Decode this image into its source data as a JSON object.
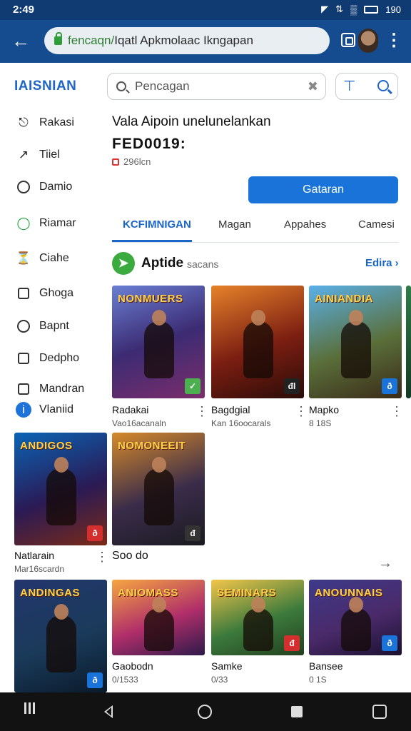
{
  "status_bar": {
    "time": "2:49",
    "battery_text": "190"
  },
  "app_bar": {
    "url_host": "fencaqn/",
    "url_path": "Iqatl Apkmolaac Ikngapan"
  },
  "sidebar": {
    "brand": "IAISNIAN",
    "items": [
      {
        "label": "Rakasi",
        "icon": "tag-icon"
      },
      {
        "label": "Tiiel",
        "icon": "share-icon"
      },
      {
        "label": "Damio",
        "icon": "search-icon"
      },
      {
        "label": "Riamar",
        "icon": "shield-icon"
      },
      {
        "label": "Ciahe",
        "icon": "timer-icon"
      },
      {
        "label": "Ghoga",
        "icon": "calendar-icon"
      },
      {
        "label": "Bapnt",
        "icon": "refresh-icon"
      },
      {
        "label": "Dedpho",
        "icon": "checklist-icon"
      },
      {
        "label": "Mandran",
        "icon": "document-icon"
      },
      {
        "label": "Vlaniid",
        "icon": "info-icon"
      }
    ]
  },
  "search": {
    "placeholder": "Pencagan"
  },
  "promo": {
    "headline": "Vala Aipoin unelunelankan",
    "amount": "FED0019:",
    "subline": "296lcn",
    "cta_label": "Gataran"
  },
  "tabs": [
    "KCFIMNIGAN",
    "Magan",
    "Appahes",
    "Camesi"
  ],
  "section": {
    "title": "Aptide",
    "subtitle": "sacans",
    "more_label": "Edira"
  },
  "cards": [
    {
      "title": "NONMUERS",
      "name": "Radakai",
      "meta": "Vao16acanaln",
      "badge": "✓",
      "badge_color": "#4caf50",
      "gradient": "g1"
    },
    {
      "title": "",
      "name": "Bagdgial",
      "meta": "Kan 16oocarals",
      "badge": "đl",
      "badge_color": "#222222",
      "gradient": "g2"
    },
    {
      "title": "AINIANDIA",
      "name": "Mapko",
      "meta": "8 18S",
      "badge": "ð",
      "badge_color": "#1a73d9",
      "gradient": "g3"
    },
    {
      "title": "ANDIGOS",
      "name": "Natlarain",
      "meta": "Mar16scardn",
      "badge": "ð",
      "badge_color": "#d32f2f",
      "gradient": "g4"
    },
    {
      "title": "NOMONEEIT",
      "name": "Soo do",
      "meta": "",
      "badge": "đ",
      "badge_color": "#333333",
      "gradient": "g5"
    },
    {
      "title": "ANDINGAS",
      "name": "",
      "meta": "",
      "badge": "ð",
      "badge_color": "#1a73d9",
      "gradient": "g6"
    },
    {
      "title": "ANIOMASS",
      "name": "Gaobodn",
      "meta": "0/1533",
      "badge": "",
      "badge_color": "",
      "gradient": "g7"
    },
    {
      "title": "SEMINARS",
      "name": "Samke",
      "meta": "0/33",
      "badge": "đ",
      "badge_color": "#d32f2f",
      "gradient": "g8"
    },
    {
      "title": "ANOUNNAIS",
      "name": "Bansee",
      "meta": "0 1S",
      "badge": "ð",
      "badge_color": "#1a73d9",
      "gradient": "g9"
    }
  ]
}
